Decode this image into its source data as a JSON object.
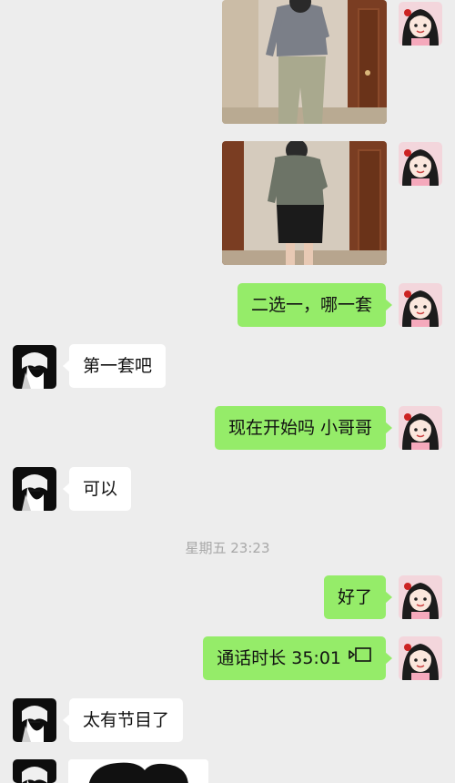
{
  "messages": {
    "photo_1": "outfit photo 1",
    "photo_2": "outfit photo 2",
    "msg_choose": "二选一，哪一套",
    "msg_first": "第一套吧",
    "msg_start": "现在开始吗 小哥哥",
    "msg_ok": "可以",
    "timestamp": "星期五 23:23",
    "msg_done": "好了",
    "msg_call": "通话时长 35:01",
    "msg_funny": "太有节目了"
  },
  "colors": {
    "background": "#ededed",
    "my_bubble": "#95ec69",
    "their_bubble": "#ffffff",
    "timestamp": "#a8a8a8"
  },
  "icons": {
    "call": "video-call-icon",
    "my_avatar": "cartoon-girl-avatar",
    "their_avatar": "anime-boy-avatar"
  }
}
